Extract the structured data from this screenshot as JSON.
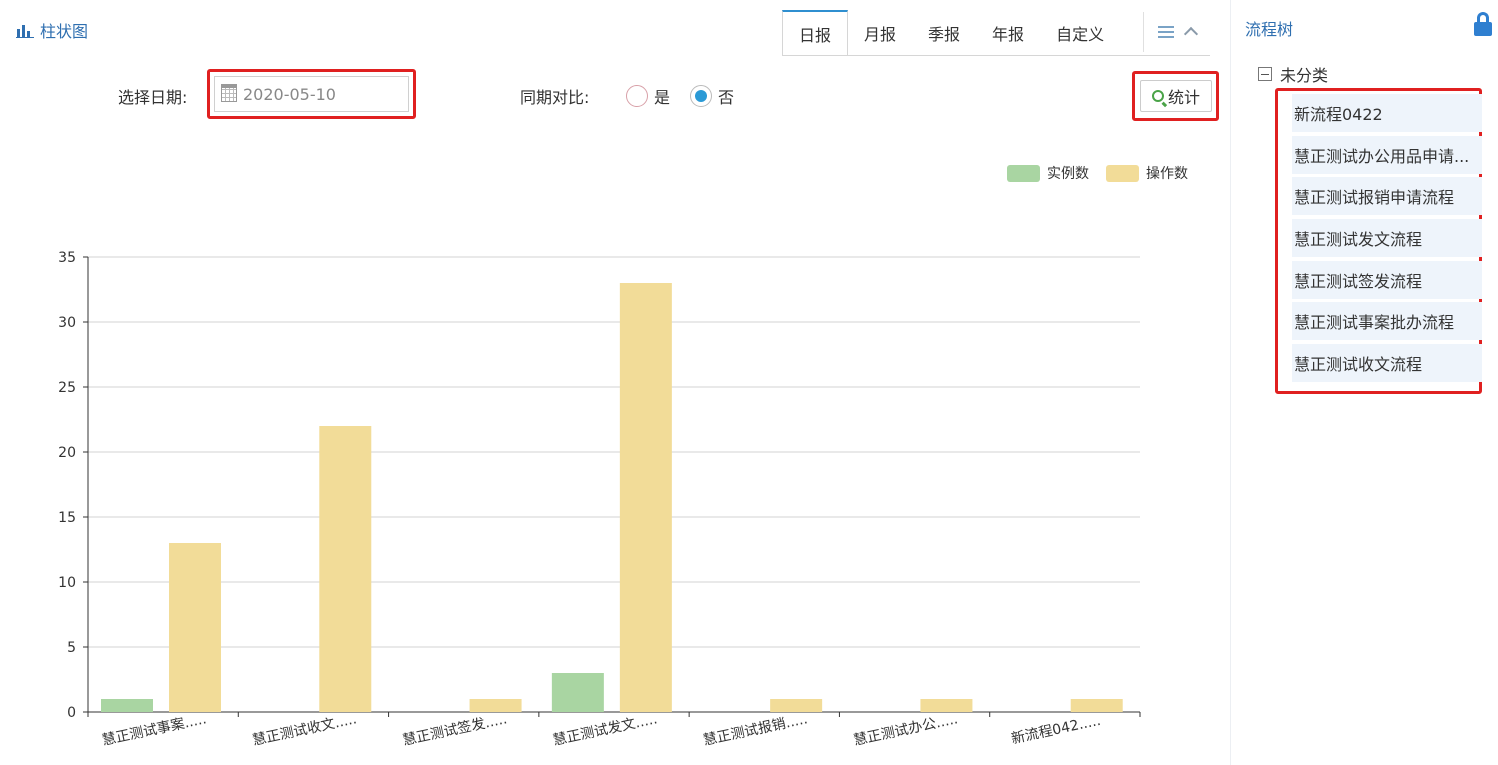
{
  "panel": {
    "title": "柱状图"
  },
  "tabs": [
    {
      "label": "日报",
      "active": true
    },
    {
      "label": "月报",
      "active": false
    },
    {
      "label": "季报",
      "active": false
    },
    {
      "label": "年报",
      "active": false
    },
    {
      "label": "自定义",
      "active": false
    }
  ],
  "form": {
    "date_label": "选择日期:",
    "date_value": "2020-05-10",
    "compare_label": "同期对比:",
    "compare_options": [
      "是",
      "否"
    ],
    "compare_selected": "否",
    "stat_button": "统计"
  },
  "colors": {
    "instance": "#a9d5a2",
    "operation": "#f2dc98",
    "accent": "#2f6fb0",
    "highlight": "#e02020"
  },
  "chart_data": {
    "type": "bar",
    "categories": [
      "慧正测试事案.....",
      "慧正测试收文.....",
      "慧正测试签发.....",
      "慧正测试发文.....",
      "慧正测试报销.....",
      "慧正测试办公.....",
      "新流程042....."
    ],
    "series": [
      {
        "name": "实例数",
        "values": [
          1,
          0,
          0,
          3,
          0,
          0,
          0
        ]
      },
      {
        "name": "操作数",
        "values": [
          13,
          22,
          1,
          33,
          1,
          1,
          1
        ]
      }
    ],
    "y_ticks": [
      "0",
      "5",
      "10",
      "15",
      "20",
      "25",
      "30",
      "35"
    ],
    "ylim": [
      0,
      35
    ],
    "grid": true,
    "legend": "top-right"
  },
  "side": {
    "title": "流程树",
    "root_label": "未分类",
    "items": [
      "新流程0422",
      "慧正测试办公用品申请...",
      "慧正测试报销申请流程",
      "慧正测试发文流程",
      "慧正测试签发流程",
      "慧正测试事案批办流程",
      "慧正测试收文流程"
    ]
  }
}
